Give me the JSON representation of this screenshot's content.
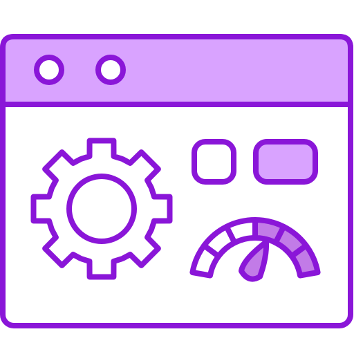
{
  "icon": {
    "name": "web-settings-performance-icon",
    "elements": [
      "browser-window-icon",
      "window-control-dot-icon",
      "window-control-dot-icon",
      "gear-icon",
      "toggle-square-button-icon",
      "toggle-pill-button-icon",
      "speedometer-gauge-icon"
    ]
  },
  "colors": {
    "stroke": "#8A16D8",
    "fill_light": "#D9A3FF",
    "fill_mid": "#C27BE7",
    "background": "#FFFFFF"
  },
  "gauge": {
    "level": 0.62
  }
}
